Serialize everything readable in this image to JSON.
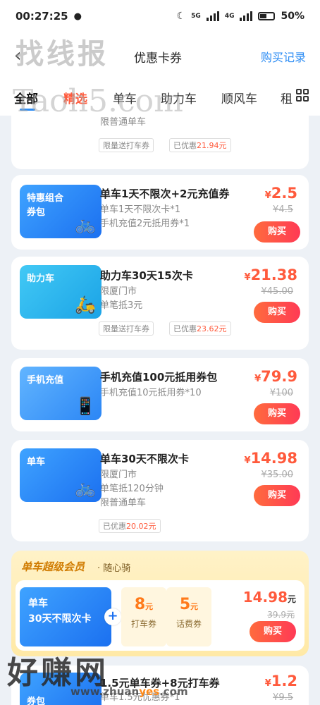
{
  "status_bar": {
    "time": "00:27:25",
    "battery": "50%",
    "net1": "5G",
    "net2": "4G"
  },
  "nav": {
    "title": "优惠卡券",
    "right_link": "购买记录"
  },
  "watermarks": {
    "top": "找线报",
    "mid": "Taoh5.com",
    "bottom": "好赚网",
    "bottom_url_a": "www.zhuan",
    "bottom_url_b": "yes",
    "bottom_url_c": ".com"
  },
  "tabs": [
    "全部",
    "精选",
    "单车",
    "助力车",
    "顺风车",
    "租"
  ],
  "cards": [
    {
      "id": "partial",
      "desc": "限普通单车",
      "tags": [
        "限量送打车券",
        "已优惠"
      ],
      "tag_amount": "21.94元"
    },
    {
      "id": "combo",
      "thumb_label": [
        "特惠组合",
        "券包"
      ],
      "title": "单车1天不限次+2元充值券",
      "desc": [
        "单车1天不限次卡*1",
        "手机充值2元抵用券*1"
      ],
      "price_symbol": "¥",
      "price": "2.5",
      "old_price": "¥4.5",
      "buy": "购买"
    },
    {
      "id": "ebike",
      "thumb_label": [
        "助力车"
      ],
      "title": "助力车30天15次卡",
      "desc": [
        "限厦门市",
        "单笔抵3元"
      ],
      "tags": [
        "限量送打车券",
        "已优惠"
      ],
      "tag_amount": "23.62元",
      "price_symbol": "¥",
      "price": "21.38",
      "old_price": "¥45.00",
      "buy": "购买"
    },
    {
      "id": "phone",
      "thumb_label": [
        "手机充值"
      ],
      "title": "手机充值100元抵用券包",
      "desc": [
        "手机充值10元抵用券*10"
      ],
      "price_symbol": "¥",
      "price": "79.9",
      "old_price": "¥100",
      "buy": "购买"
    },
    {
      "id": "bike30",
      "thumb_label": [
        "单车"
      ],
      "title": "单车30天不限次卡",
      "desc": [
        "限厦门市",
        "单笔抵120分钟",
        "限普通单车"
      ],
      "tags": [
        "已优惠"
      ],
      "tag_amount": "20.02元",
      "price_symbol": "¥",
      "price": "14.98",
      "old_price": "¥35.00",
      "buy": "购买"
    }
  ],
  "vip": {
    "title": "单车超级会员",
    "subtitle": "· 随心骑",
    "card_line1": "单车",
    "card_line2": "30天不限次卡",
    "plus": "+",
    "coupon1_amount": "8",
    "coupon1_unit": "元",
    "coupon1_label": "打车券",
    "coupon2_amount": "5",
    "coupon2_unit": "元",
    "coupon2_label": "话费券",
    "price": "14.98",
    "price_unit": "元",
    "old_price": "39.9元",
    "buy": "购买"
  },
  "bottom_card": {
    "thumb_label": "券包",
    "title": "1.5元单车券+8元打车券",
    "desc": "单车1.5元优惠券*1",
    "price_symbol": "¥",
    "price": "1.2",
    "old_price": "¥9.5"
  },
  "colors": {
    "accent_blue": "#2c8cf4",
    "price_red": "#ff5a3c",
    "vip_gold": "#d07b00"
  }
}
